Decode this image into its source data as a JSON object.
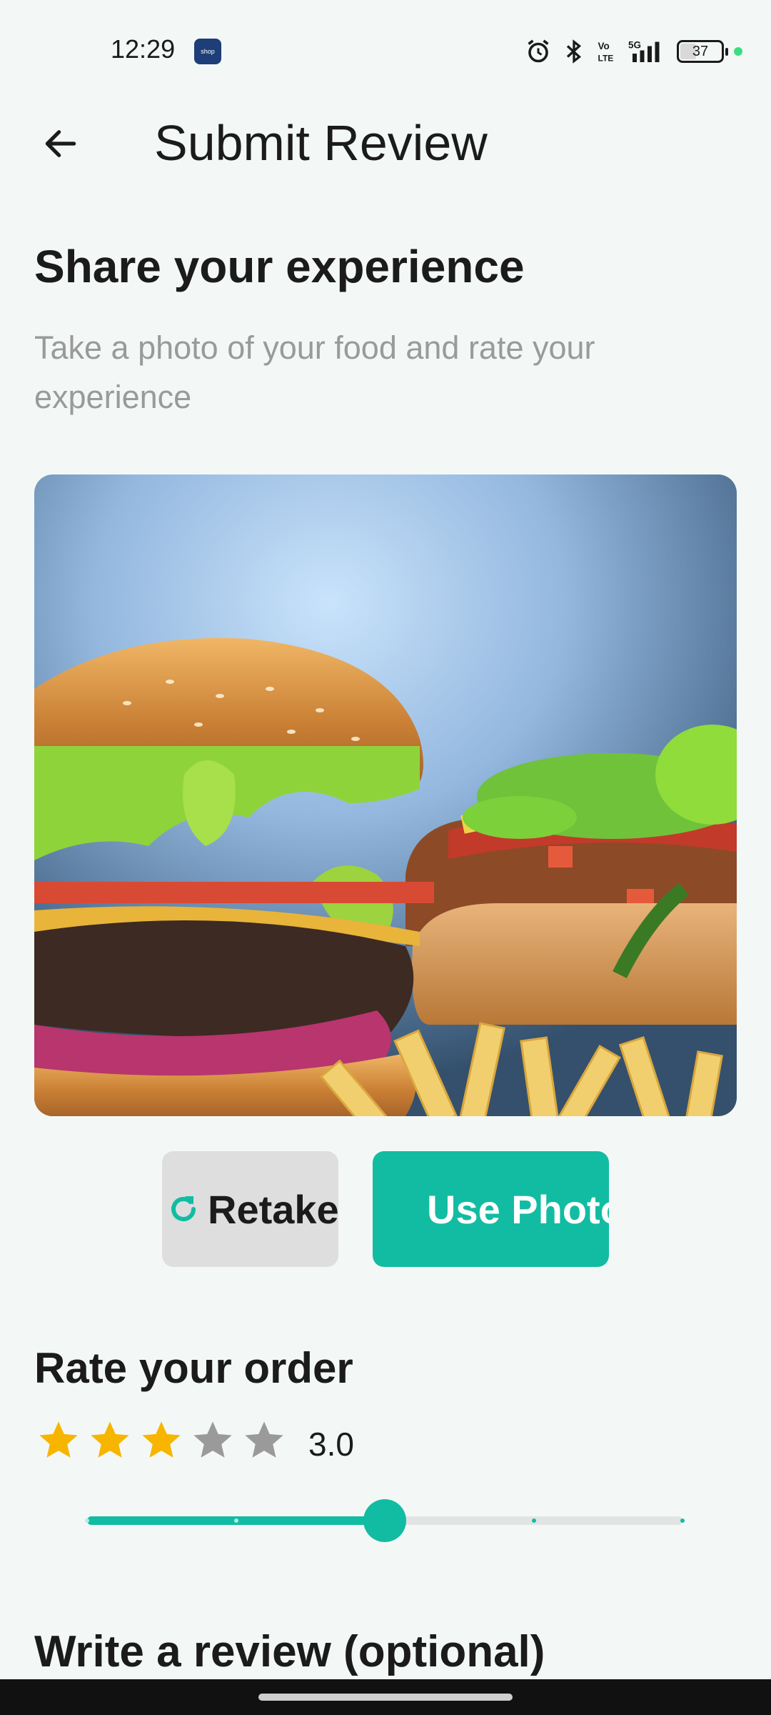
{
  "status_bar": {
    "time": "12:29",
    "app_badge": "shop",
    "battery": "37",
    "icons": [
      "alarm-icon",
      "bluetooth-icon",
      "volte-icon",
      "signal-5g-icon",
      "battery-icon",
      "notification-dot"
    ]
  },
  "header": {
    "title": "Submit Review"
  },
  "intro": {
    "heading": "Share your experience",
    "subtitle": "Take a photo of your food and rate your experience"
  },
  "photo_actions": {
    "retake_label": "Retake",
    "use_photo_label": "Use Photo"
  },
  "rating": {
    "heading": "Rate your order",
    "value_text": "3.0",
    "stars_filled": 3,
    "stars_total": 5,
    "slider_value": 3,
    "slider_min": 1,
    "slider_max": 5
  },
  "review": {
    "heading": "Write a review (optional)"
  },
  "colors": {
    "accent": "#12bca2",
    "star_filled": "#f7b500",
    "star_empty": "#9a9a9a",
    "background": "#f3f8f6"
  }
}
